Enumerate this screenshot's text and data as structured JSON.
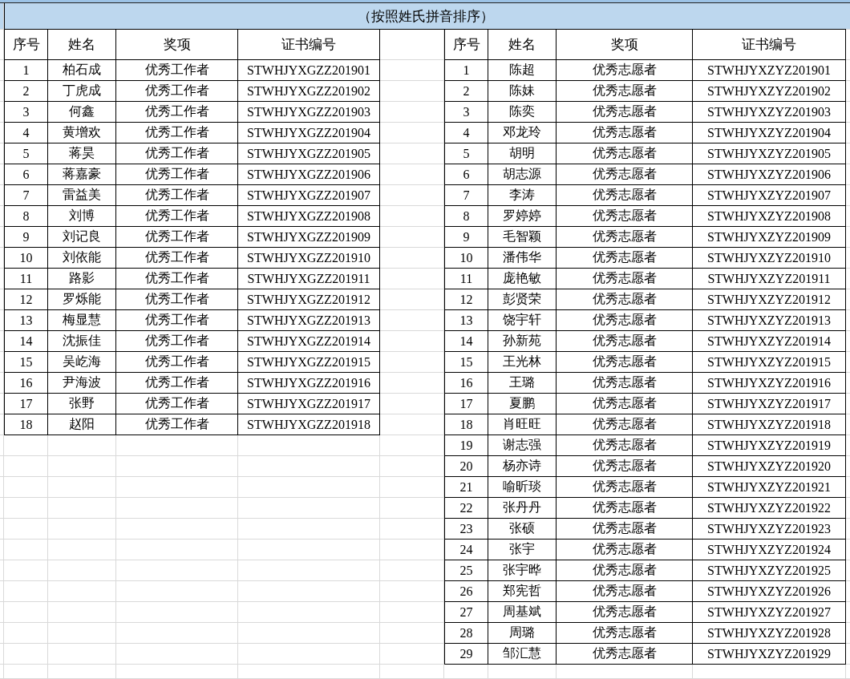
{
  "title": "（按照姓氏拼音排序）",
  "tables": [
    {
      "columns": [
        "序号",
        "姓名",
        "奖项",
        "证书编号"
      ],
      "rows": [
        [
          "1",
          "柏石成",
          "优秀工作者",
          "STWHJYXGZZ201901"
        ],
        [
          "2",
          "丁虎成",
          "优秀工作者",
          "STWHJYXGZZ201902"
        ],
        [
          "3",
          "何鑫",
          "优秀工作者",
          "STWHJYXGZZ201903"
        ],
        [
          "4",
          "黄增欢",
          "优秀工作者",
          "STWHJYXGZZ201904"
        ],
        [
          "5",
          "蒋昊",
          "优秀工作者",
          "STWHJYXGZZ201905"
        ],
        [
          "6",
          "蒋嘉豪",
          "优秀工作者",
          "STWHJYXGZZ201906"
        ],
        [
          "7",
          "雷益美",
          "优秀工作者",
          "STWHJYXGZZ201907"
        ],
        [
          "8",
          "刘博",
          "优秀工作者",
          "STWHJYXGZZ201908"
        ],
        [
          "9",
          "刘记良",
          "优秀工作者",
          "STWHJYXGZZ201909"
        ],
        [
          "10",
          "刘依能",
          "优秀工作者",
          "STWHJYXGZZ201910"
        ],
        [
          "11",
          "路影",
          "优秀工作者",
          "STWHJYXGZZ201911"
        ],
        [
          "12",
          "罗烁能",
          "优秀工作者",
          "STWHJYXGZZ201912"
        ],
        [
          "13",
          "梅显慧",
          "优秀工作者",
          "STWHJYXGZZ201913"
        ],
        [
          "14",
          "沈振佳",
          "优秀工作者",
          "STWHJYXGZZ201914"
        ],
        [
          "15",
          "吴屹海",
          "优秀工作者",
          "STWHJYXGZZ201915"
        ],
        [
          "16",
          "尹海波",
          "优秀工作者",
          "STWHJYXGZZ201916"
        ],
        [
          "17",
          "张野",
          "优秀工作者",
          "STWHJYXGZZ201917"
        ],
        [
          "18",
          "赵阳",
          "优秀工作者",
          "STWHJYXGZZ201918"
        ]
      ]
    },
    {
      "columns": [
        "序号",
        "姓名",
        "奖项",
        "证书编号"
      ],
      "rows": [
        [
          "1",
          "陈超",
          "优秀志愿者",
          "STWHJYXZYZ201901"
        ],
        [
          "2",
          "陈妹",
          "优秀志愿者",
          "STWHJYXZYZ201902"
        ],
        [
          "3",
          "陈奕",
          "优秀志愿者",
          "STWHJYXZYZ201903"
        ],
        [
          "4",
          "邓龙玲",
          "优秀志愿者",
          "STWHJYXZYZ201904"
        ],
        [
          "5",
          "胡明",
          "优秀志愿者",
          "STWHJYXZYZ201905"
        ],
        [
          "6",
          "胡志源",
          "优秀志愿者",
          "STWHJYXZYZ201906"
        ],
        [
          "7",
          "李涛",
          "优秀志愿者",
          "STWHJYXZYZ201907"
        ],
        [
          "8",
          "罗婷婷",
          "优秀志愿者",
          "STWHJYXZYZ201908"
        ],
        [
          "9",
          "毛智颖",
          "优秀志愿者",
          "STWHJYXZYZ201909"
        ],
        [
          "10",
          "潘伟华",
          "优秀志愿者",
          "STWHJYXZYZ201910"
        ],
        [
          "11",
          "庞艳敏",
          "优秀志愿者",
          "STWHJYXZYZ201911"
        ],
        [
          "12",
          "彭贤荣",
          "优秀志愿者",
          "STWHJYXZYZ201912"
        ],
        [
          "13",
          "饶宇轩",
          "优秀志愿者",
          "STWHJYXZYZ201913"
        ],
        [
          "14",
          "孙新苑",
          "优秀志愿者",
          "STWHJYXZYZ201914"
        ],
        [
          "15",
          "王光林",
          "优秀志愿者",
          "STWHJYXZYZ201915"
        ],
        [
          "16",
          "王璐",
          "优秀志愿者",
          "STWHJYXZYZ201916"
        ],
        [
          "17",
          "夏鹏",
          "优秀志愿者",
          "STWHJYXZYZ201917"
        ],
        [
          "18",
          "肖旺旺",
          "优秀志愿者",
          "STWHJYXZYZ201918"
        ],
        [
          "19",
          "谢志强",
          "优秀志愿者",
          "STWHJYXZYZ201919"
        ],
        [
          "20",
          "杨亦诗",
          "优秀志愿者",
          "STWHJYXZYZ201920"
        ],
        [
          "21",
          "喻昕琰",
          "优秀志愿者",
          "STWHJYXZYZ201921"
        ],
        [
          "22",
          "张丹丹",
          "优秀志愿者",
          "STWHJYXZYZ201922"
        ],
        [
          "23",
          "张硕",
          "优秀志愿者",
          "STWHJYXZYZ201923"
        ],
        [
          "24",
          "张宇",
          "优秀志愿者",
          "STWHJYXZYZ201924"
        ],
        [
          "25",
          "张宇晔",
          "优秀志愿者",
          "STWHJYXZYZ201925"
        ],
        [
          "26",
          "郑宪哲",
          "优秀志愿者",
          "STWHJYXZYZ201926"
        ],
        [
          "27",
          "周基斌",
          "优秀志愿者",
          "STWHJYXZYZ201927"
        ],
        [
          "28",
          "周璐",
          "优秀志愿者",
          "STWHJYXZYZ201928"
        ],
        [
          "29",
          "邹汇慧",
          "优秀志愿者",
          "STWHJYXZYZ201929"
        ]
      ]
    }
  ]
}
